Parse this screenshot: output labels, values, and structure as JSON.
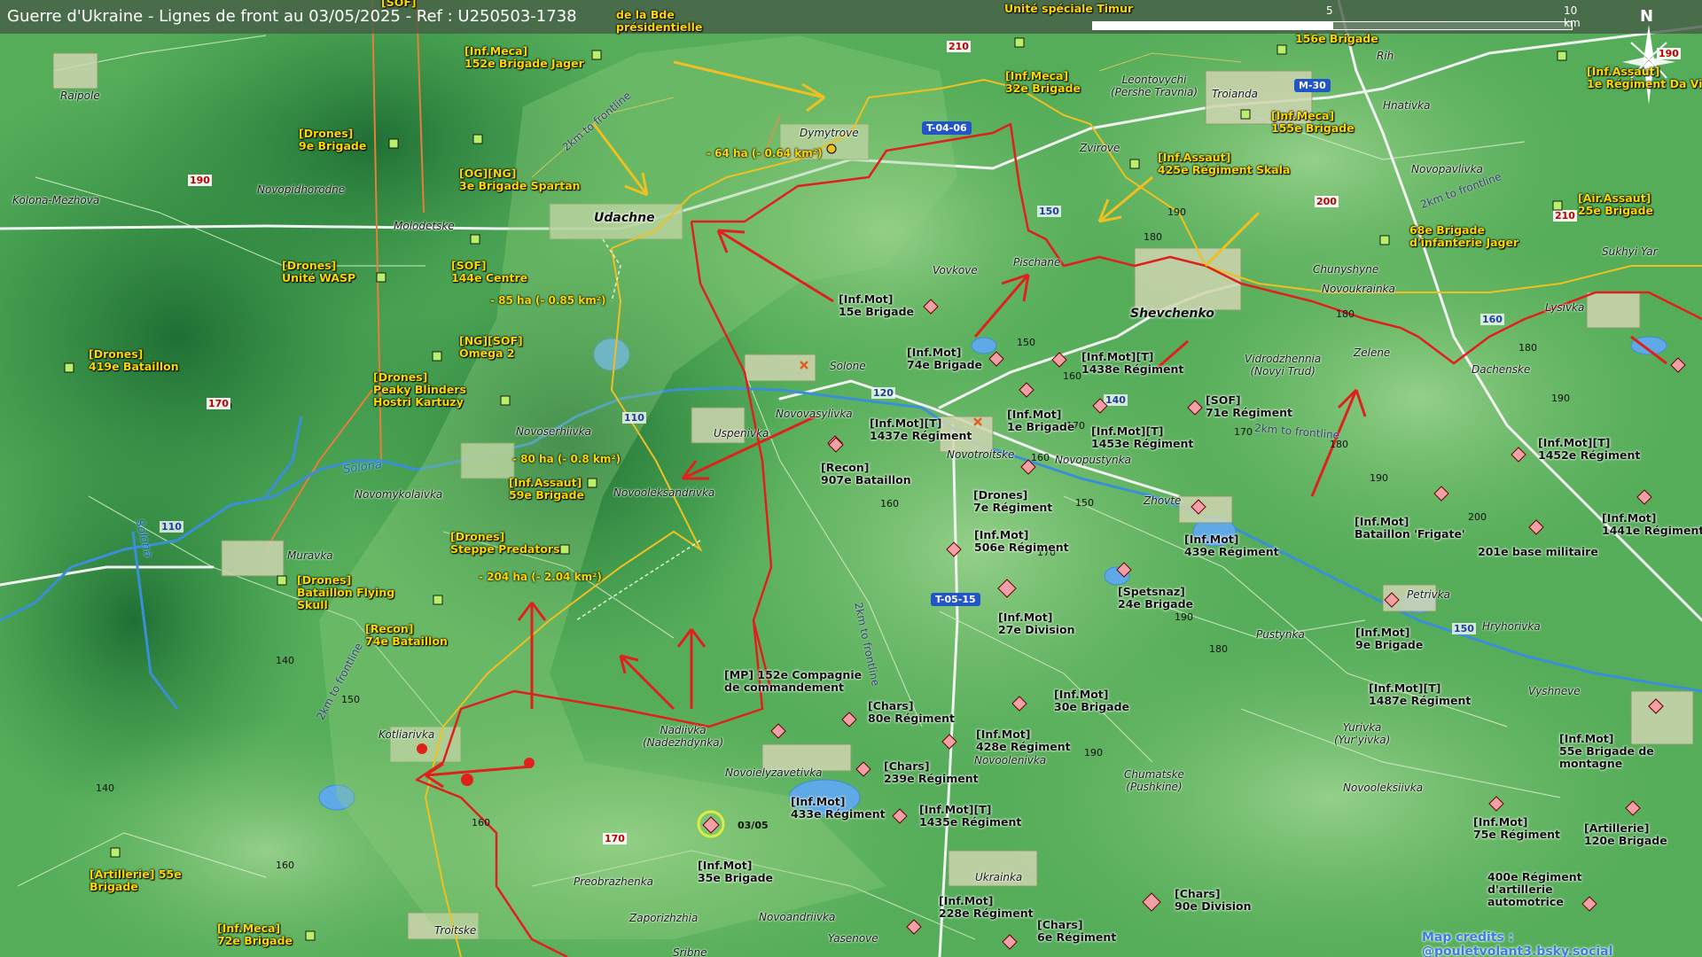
{
  "title": "Guerre d'Ukraine - Lignes de front au 03/05/2025 - Ref : U250503-1738",
  "scale": {
    "mid": "5",
    "end": "10 km"
  },
  "north": "N",
  "credits": "Map credits : @pouletvolant3.bsky.social",
  "date_marker": "03/05",
  "cities": {
    "udachne": "Udachne",
    "shevchenko": "Shevchenko"
  },
  "towns": {
    "raipole": "Raipole",
    "kolona": "Kolona-Mezhova",
    "novopidhorodne": "Novopidhorodne",
    "molodetske": "Molodetske",
    "dymytrove": "Dymytrove",
    "leontovychi": "Leontovychi\n(Pershe Travnia)",
    "troianda": "Troianda",
    "rih": "Rih",
    "hnativka": "Hnativka",
    "zvirove": "Zvirove",
    "novopavlivka": "Novopavlivka",
    "vovkove": "Vovkove",
    "pischane": "Pischane",
    "chunyshyne": "Chunyshyne",
    "novoukrainka": "Novoukrainka",
    "sukhyi_yar": "Sukhyi Yar",
    "lysivka": "Lysivka",
    "solone": "Solone",
    "novovasylivka": "Novovasylivka",
    "uspenivka": "Uspenivka",
    "novoserhiivka": "Novoserhiivka",
    "vidrodzhennia": "Vidrodzhennia\n(Novyi Trud)",
    "zelene": "Zelene",
    "dachenske": "Dachenske",
    "novomykolaivka": "Novomykolaivka",
    "novooleksandrivka": "Novooleksandrivka",
    "novotroitske": "Novotroitske",
    "novopustynka": "Novopustynka",
    "zhovte": "Zhovte",
    "muravka": "Muravka",
    "kotliarivka": "Kotliarivka",
    "nadiivka": "Nadiivka\n(Nadezhdynka)",
    "novoielyzavetivka": "Novoielyzavetivka",
    "novoolenivka": "Novoolenivka",
    "chumatske": "Chumatske\n(Pushkine)",
    "pustynka": "Pustynka",
    "petrivka": "Petrivka",
    "hryhorivka": "Hryhorivka",
    "vyshneve": "Vyshneve",
    "yurivka": "Yurivka\n(Yur'yivka)",
    "novooleksiivka": "Novooleksiivka",
    "preobrazhenka": "Preobrazhenka",
    "zaporizhzhia": "Zaporizhzhia",
    "novoandriivka": "Novoandriivka",
    "ukrainka": "Ukrainka",
    "yasenove": "Yasenove",
    "troitske": "Troitske",
    "sribne": "Sribne"
  },
  "rivers": {
    "solona1": "Solona",
    "solona2": "Solona"
  },
  "roads": {
    "t0406": "T-04-06",
    "t0515": "T-05-15",
    "m30": "M-30"
  },
  "road_numbers": {
    "r110a": "110",
    "r110b": "110",
    "r120": "120",
    "r140": "140",
    "r150a": "150",
    "r150b": "150",
    "r160": "160"
  },
  "frontline_labels": {
    "f1": "2km to frontline",
    "f2": "2km to frontline",
    "f3": "2km to frontline",
    "f4": "2km to frontline",
    "f5": "2km to frontline"
  },
  "altitudes": {
    "a1": "170",
    "a2": "140",
    "a3": "150",
    "a4": "140",
    "a5": "160",
    "a6": "160",
    "a7": "160",
    "a8": "150",
    "a9": "170",
    "a10": "180",
    "a11": "190",
    "a12": "180",
    "a13": "150",
    "a14": "160",
    "a15": "190",
    "a16": "180",
    "a17": "190",
    "a18": "200",
    "a19": "190",
    "a20": "180",
    "a21": "180",
    "a22": "170",
    "a23": "190",
    "a24": "160",
    "a25": "170"
  },
  "altitudes_red": {
    "r1": "190",
    "r2": "170",
    "r3": "210",
    "r4": "210",
    "r5": "200",
    "r6": "170",
    "r7": "190"
  },
  "areas": {
    "a64": "- 64 ha (- 0.64 km²)",
    "a85": "- 85 ha (- 0.85 km²)",
    "a80": "- 80 ha (- 0.8 km²)",
    "a204": "- 204 ha (- 2.04 km²)"
  },
  "units_ua": {
    "u1": "[SOF]",
    "u2": "de la Bde\nprésidentielle",
    "u3": "Unité spéciale Timur",
    "u4": "[Inf.Meca]\n152e Brigade Jager",
    "u5": "[Drones]\n9e Brigade",
    "u6": "[OG][NG]\n3e Brigade Spartan",
    "u7": "[Inf.Meca]\n32e Brigade",
    "u8": "156e Brigade",
    "u9": "[Inf.Meca]\n155e Brigade",
    "u10": "[Inf.Assaut]\n425e Régiment Skala",
    "u11": "[Inf.Assaut]\n1e Régiment Da Vinci",
    "u12": "[Air.Assaut]\n25e Brigade",
    "u13": "68e Brigade\nd'infanterie Jager",
    "u14": "[Drones]\nUnité WASP",
    "u15": "[SOF]\n144e Centre",
    "u16": "[NG][SOF]\nOmega 2",
    "u17": "[Drones]\n419e Bataillon",
    "u18": "[Drones]\nPeaky Blinders\nHostri Kartuzy",
    "u19": "[Inf.Assaut]\n59e Brigade",
    "u20": "[Drones]\nSteppe Predators",
    "u21": "[Drones]\nBataillon Flying\nSkull",
    "u22": "[Recon]\n74e Bataillon",
    "u23": "[Artillerie] 55e\nBrigade",
    "u24": "[Inf.Meca]\n72e Brigade"
  },
  "units_ru": {
    "r1": "[Inf.Mot]\n15e Brigade",
    "r2": "[Inf.Mot]\n74e Brigade",
    "r3": "[Inf.Mot][T]\n1438e Régiment",
    "r4": "[Inf.Mot][T]\n1437e Régiment",
    "r5": "[Inf.Mot]\n1e Brigade",
    "r6": "[Inf.Mot][T]\n1453e Régiment",
    "r7": "[SOF]\n71e Régiment",
    "r8": "[Recon]\n907e Bataillon",
    "r9": "[Drones]\n7e Régiment",
    "r10": "[Inf.Mot]\n506e Régiment",
    "r11": "[Inf.Mot]\n439e Régiment",
    "r12": "[Inf.Mot][T]\n1452e Régiment",
    "r13": "[Inf.Mot]\nBataillon 'Frigate'",
    "r14": "[Inf.Mot]\n1441e Régiment",
    "r15": "201e base militaire",
    "r16": "[Inf.Mot]\n27e Division",
    "r17": "[Spetsnaz]\n24e Brigade",
    "r18": "[Inf.Mot]\n9e Brigade",
    "r19": "[Inf.Mot][T]\n1487e Régiment",
    "r20": "[MP] 152e Compagnie\nde commandement",
    "r21": "[Chars]\n80e Régiment",
    "r22": "[Inf.Mot]\n30e Brigade",
    "r23": "[Inf.Mot]\n428e Régiment",
    "r24": "[Chars]\n239e Régiment",
    "r25": "[Inf.Mot]\n433e Régiment",
    "r26": "[Inf.Mot][T]\n1435e Régiment",
    "r27": "[Inf.Mot]\n55e Brigade de\nmontagne",
    "r28": "[Inf.Mot]\n75e Régiment",
    "r29": "[Artillerie]\n120e Brigade",
    "r30": "[Inf.Mot]\n35e Brigade",
    "r31": "[Inf.Mot]\n228e Régiment",
    "r32": "[Chars]\n6e Régiment",
    "r33": "[Chars]\n90e Division",
    "r34": "400e Régiment\nd'artillerie\nautomotrice"
  },
  "colors": {
    "front_ru": "#e0201c",
    "front_ua": "#f0c020",
    "water": "#3a8fd8",
    "terrain_dark": "#237a3a",
    "terrain_light": "#7cc474"
  }
}
